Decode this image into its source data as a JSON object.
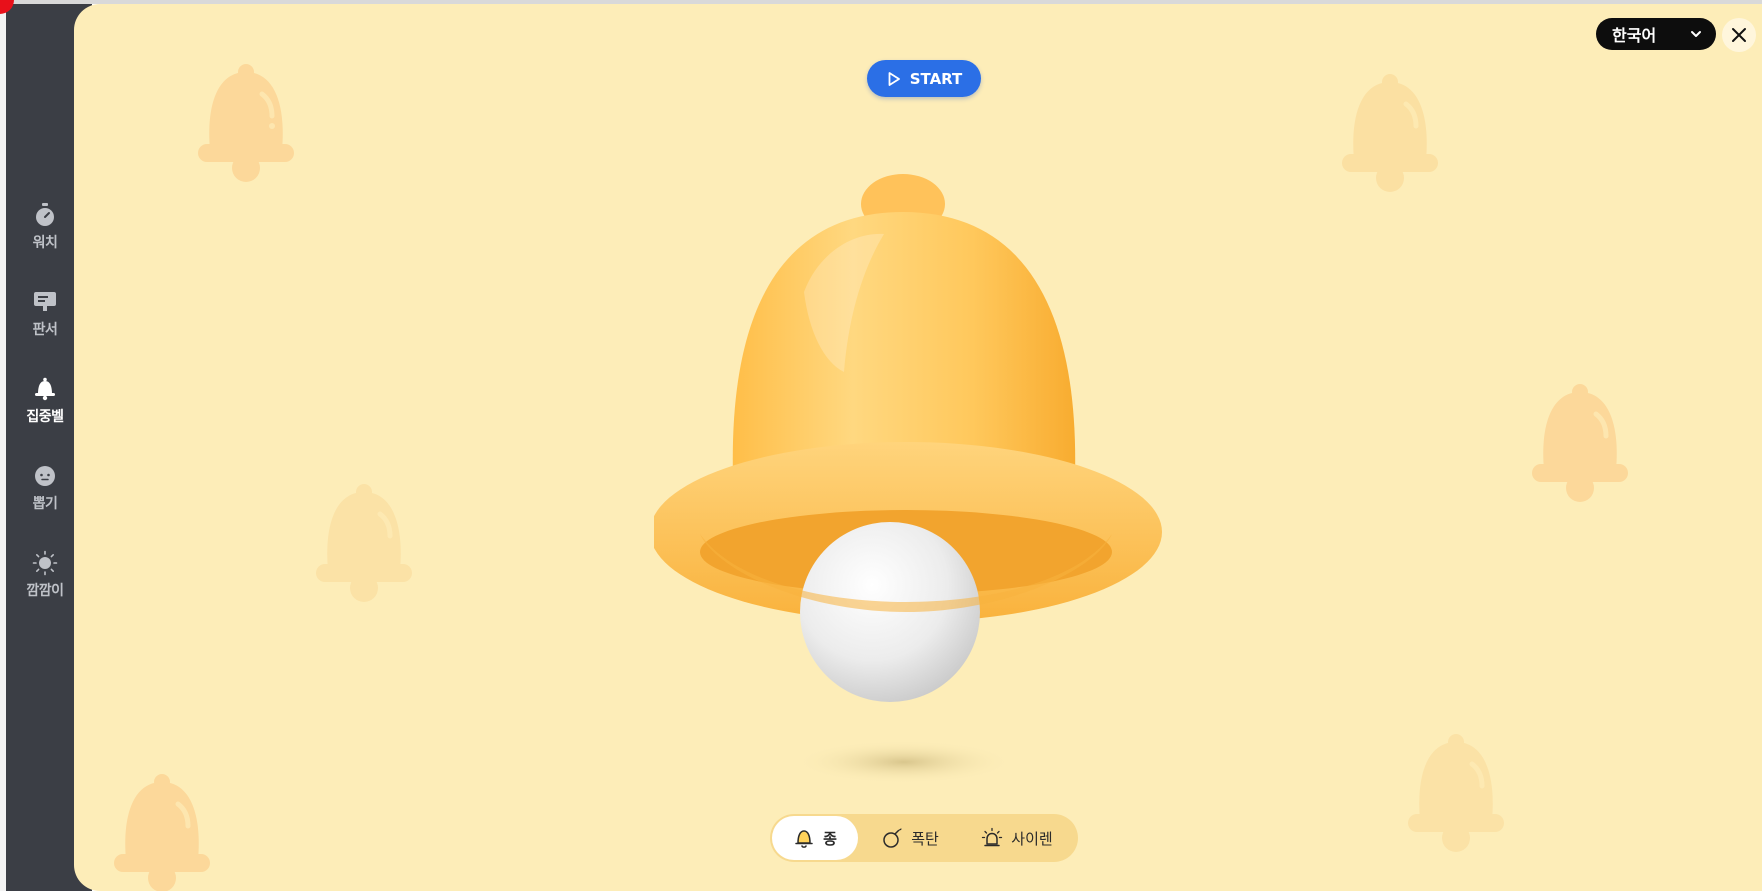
{
  "sidebar": {
    "items": [
      {
        "label": "워치",
        "icon": "stopwatch-icon"
      },
      {
        "label": "판서",
        "icon": "board-icon"
      },
      {
        "label": "집중벨",
        "icon": "bell-icon",
        "active": true
      },
      {
        "label": "뽑기",
        "icon": "face-icon"
      },
      {
        "label": "깜깜이",
        "icon": "sun-icon"
      }
    ]
  },
  "toolbar": {
    "start_label": "START",
    "language": "한국어",
    "close_icon": "close-icon"
  },
  "sound_options": [
    {
      "label": "종",
      "icon": "bell-outline-icon",
      "selected": true
    },
    {
      "label": "폭탄",
      "icon": "bomb-icon"
    },
    {
      "label": "사이렌",
      "icon": "siren-icon"
    }
  ],
  "colors": {
    "stage_background": "#fdedb8",
    "sidebar_background": "#3b3e45",
    "accent_blue": "#2b6fe6",
    "bell_yellow": "#ffc04a"
  }
}
